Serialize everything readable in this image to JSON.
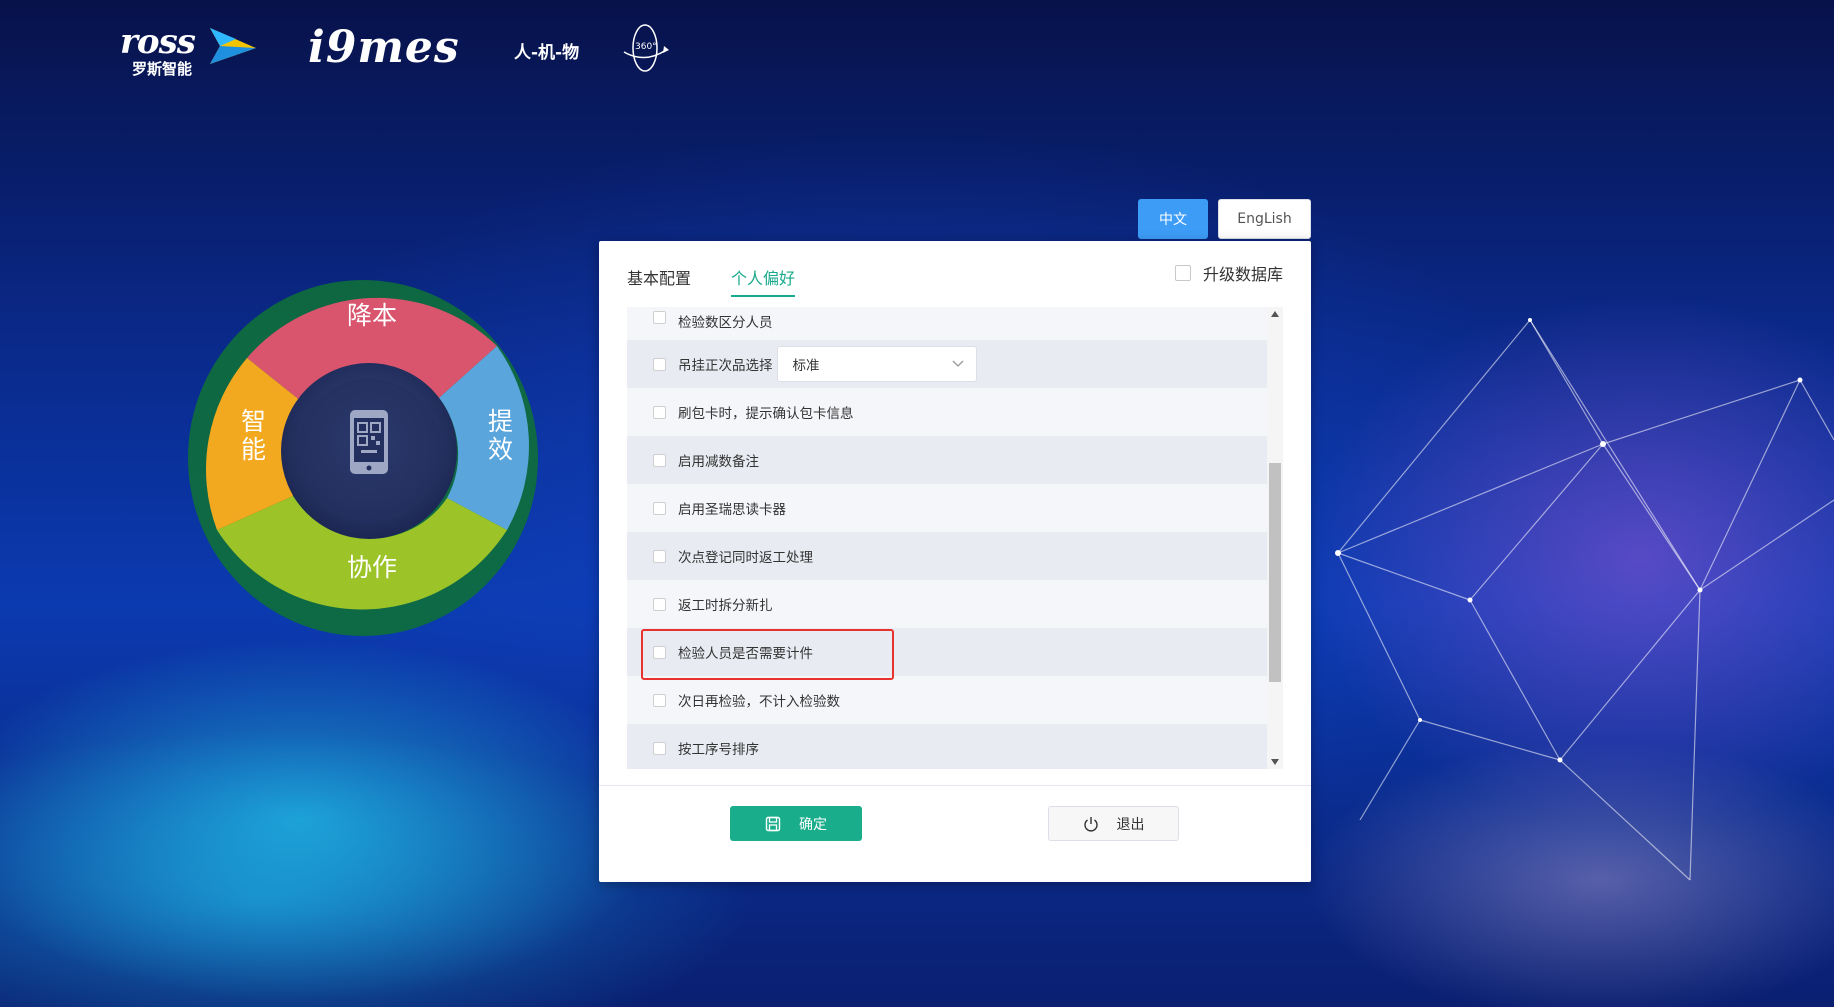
{
  "header": {
    "brand_word": "ross",
    "brand_cn": "罗斯智能",
    "product": "i9mes",
    "tagline": "人-机-物",
    "badge": "360°"
  },
  "wheel": {
    "segments": [
      "降本",
      "提效",
      "协作",
      "智能"
    ],
    "center_icon": "mobile-qr-icon"
  },
  "language": {
    "zh_label": "中文",
    "en_label": "EngLish",
    "active": "zh"
  },
  "tabs": [
    {
      "label": "基本配置",
      "active": false
    },
    {
      "label": "个人偏好",
      "active": true
    }
  ],
  "upgrade_db": {
    "label": "升级数据库",
    "checked": false
  },
  "options": [
    {
      "label": "检验数区分人员",
      "checked": false
    },
    {
      "label": "吊挂正次品选择",
      "checked": false,
      "select_value": "标准"
    },
    {
      "label": "刷包卡时，提示确认包卡信息",
      "checked": false
    },
    {
      "label": "启用减数备注",
      "checked": false
    },
    {
      "label": "启用圣瑞思读卡器",
      "checked": false
    },
    {
      "label": "次点登记同时返工处理",
      "checked": false
    },
    {
      "label": "返工时拆分新扎",
      "checked": false
    },
    {
      "label": "检验人员是否需要计件",
      "checked": false,
      "highlighted": true
    },
    {
      "label": "次日再检验，不计入检验数",
      "checked": false
    },
    {
      "label": "按工序号排序",
      "checked": false
    }
  ],
  "actions": {
    "confirm_label": "确定",
    "exit_label": "退出"
  },
  "colors": {
    "accent": "#1aad8c",
    "lang_active": "#3d9cf6",
    "highlight": "#e8322d"
  }
}
